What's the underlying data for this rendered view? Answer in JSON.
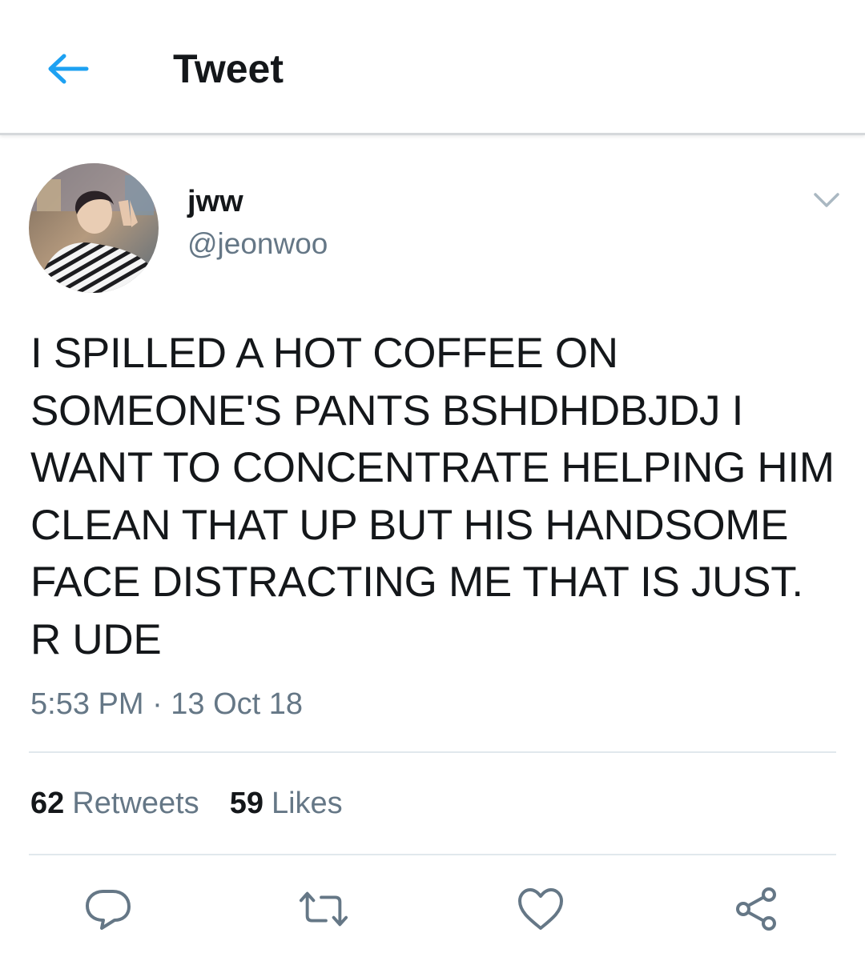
{
  "header": {
    "title": "Tweet",
    "back_icon": "arrow-left-icon",
    "accent_color": "#1da1f2"
  },
  "tweet": {
    "author": {
      "display_name": "jww",
      "handle": "@jeonwoo"
    },
    "text": "I SPILLED A HOT COFFEE ON\nSOMEONE'S PANTS BSHDHDBJDJ I\nWANT TO CONCENTRATE HELPING HIM\nCLEAN THAT UP BUT HIS HANDSOME\nFACE DISTRACTING ME THAT IS JUST.\nR UDE",
    "timestamp": "5:53 PM · 13 Oct 18",
    "stats": {
      "retweets_count": "62",
      "retweets_label": "Retweets",
      "likes_count": "59",
      "likes_label": "Likes"
    }
  },
  "actions": {
    "reply_icon": "reply-icon",
    "retweet_icon": "retweet-icon",
    "like_icon": "heart-icon",
    "share_icon": "share-icon",
    "icon_color": "#657786"
  }
}
